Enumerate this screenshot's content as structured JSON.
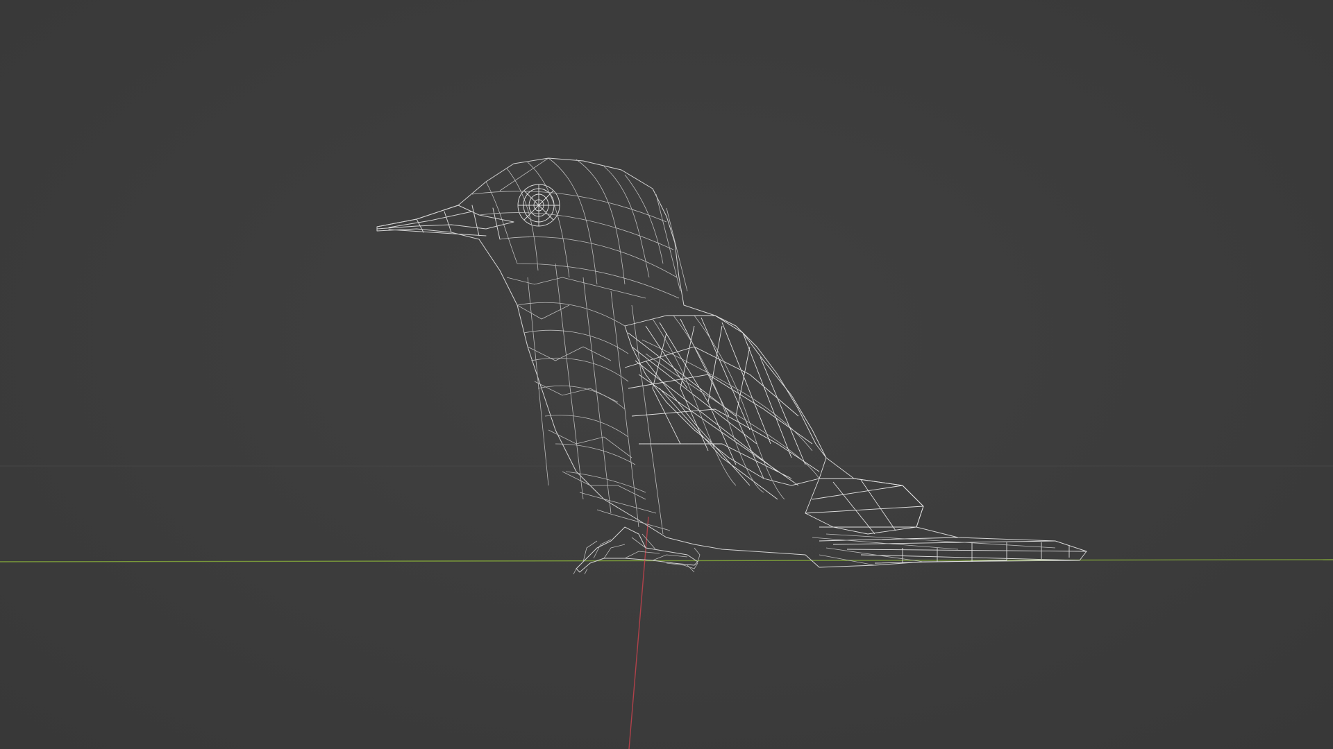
{
  "viewport": {
    "background_color": "#3d3d3d",
    "shading_mode": "wireframe",
    "axis_colors": {
      "x_axis": "#7a9a3a",
      "y_axis": "#b0414a"
    },
    "wire_color": "#d4d4d4"
  },
  "scene": {
    "object_icon": "bird-mesh-icon"
  }
}
